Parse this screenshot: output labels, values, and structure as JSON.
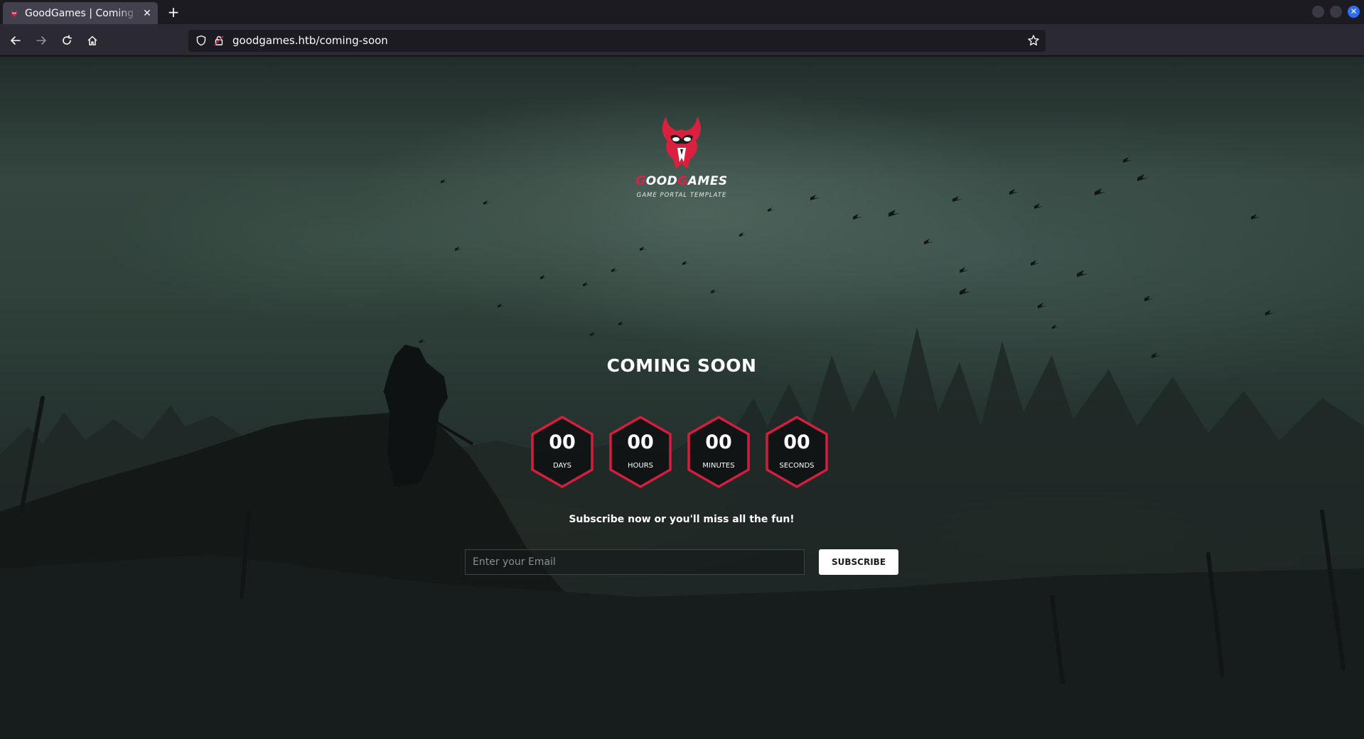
{
  "browser": {
    "tab_title": "GoodGames | Coming Soon",
    "new_tab_label": "+",
    "url": "goodgames.htb/coming-soon"
  },
  "brand": {
    "name_part1_initial": "G",
    "name_part1_rest": "OOD",
    "name_part2_initial": "G",
    "name_part2_rest": "AMES",
    "tagline": "GAME PORTAL TEMPLATE",
    "accent_color": "#e21f43"
  },
  "main": {
    "heading": "COMING SOON",
    "countdown": [
      {
        "value": "00",
        "label": "DAYS"
      },
      {
        "value": "00",
        "label": "HOURS"
      },
      {
        "value": "00",
        "label": "MINUTES"
      },
      {
        "value": "00",
        "label": "SECONDS"
      }
    ],
    "subscribe_text": "Subscribe now or you'll miss all the fun!",
    "email_placeholder": "Enter your Email",
    "subscribe_button": "SUBSCRIBE"
  },
  "icons": {
    "back": "arrow-left-icon",
    "forward": "arrow-right-icon",
    "reload": "reload-icon",
    "home": "home-icon",
    "shield": "shield-icon",
    "lock": "lock-icon",
    "bookmark": "star-icon",
    "tab_close": "close-icon"
  }
}
